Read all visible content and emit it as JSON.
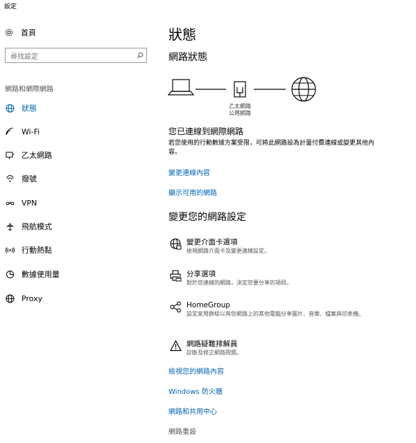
{
  "window": {
    "title": "設定"
  },
  "sidebar": {
    "home_label": "首頁",
    "search_placeholder": "尋找設定",
    "section_title": "網路和網際網路",
    "items": [
      {
        "label": "狀態",
        "icon": "globe-status-icon",
        "active": true
      },
      {
        "label": "Wi-Fi",
        "icon": "wifi-icon"
      },
      {
        "label": "乙太網路",
        "icon": "ethernet-icon"
      },
      {
        "label": "撥號",
        "icon": "dialup-icon"
      },
      {
        "label": "VPN",
        "icon": "vpn-icon"
      },
      {
        "label": "飛航模式",
        "icon": "airplane-icon"
      },
      {
        "label": "行動熱點",
        "icon": "hotspot-icon"
      },
      {
        "label": "數據使用量",
        "icon": "data-usage-icon"
      },
      {
        "label": "Proxy",
        "icon": "globe-icon"
      }
    ]
  },
  "main": {
    "title": "狀態",
    "network_status_heading": "網路狀態",
    "diagram": {
      "adapter_name": "乙太網路",
      "network_type": "公用網路"
    },
    "connected_heading": "您已連線到網際網路",
    "connected_text": "若您使用的行動數據方案受限，可將此網路設為計量付費連線或變更其他內容。",
    "links": {
      "change_props": "變更連線內容",
      "show_available": "顯示可用的網路"
    },
    "change_settings_heading": "變更您的網路設定",
    "options": [
      {
        "title": "變更介面卡選項",
        "desc": "檢視網路介面卡及變更連線設定。",
        "icon": "adapter-globe-icon"
      },
      {
        "title": "分享選項",
        "desc": "對於您連線的網路，決定您要分享的項目。",
        "icon": "sharing-printer-icon"
      },
      {
        "title": "HomeGroup",
        "desc": "設定家用群組以與您網路上的其他電腦分享圖片、音樂、檔案與印表機。",
        "icon": "homegroup-icon"
      },
      {
        "title": "網路疑難排解員",
        "desc": "診斷及修正網路問題。",
        "icon": "warning-icon"
      }
    ],
    "bottom_links": {
      "view_props": "檢視您的網路內容",
      "firewall": "Windows 防火牆",
      "sharing_center": "網路和共用中心",
      "reset": "網路重設"
    }
  }
}
